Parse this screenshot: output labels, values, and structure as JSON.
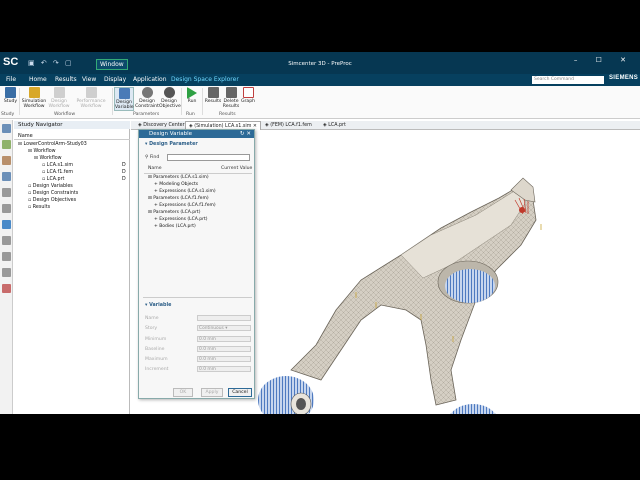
{
  "title_bar": {
    "logo": "SC",
    "window_menu": "Window",
    "title": "Simcenter 3D - PreProc",
    "controls": "– ☐ ✕"
  },
  "menu": {
    "items": [
      "File",
      "Home",
      "Results",
      "View",
      "Display",
      "Application",
      "Design Space Explorer"
    ],
    "search_placeholder": "Search Command",
    "brand": "SIEMENS"
  },
  "ribbon": {
    "buttons": [
      {
        "label": "Study",
        "color": "#3a6ea5"
      },
      {
        "label": "Simulation Workflow",
        "color": "#d8a82a"
      },
      {
        "label": "Design Workflow",
        "color": "#bbbbbb"
      },
      {
        "label": "Performance Workflow",
        "color": "#bbbbbb"
      },
      {
        "label": "Design Variable",
        "color": "#4a7bb7"
      },
      {
        "label": "Design Constraint",
        "color": "#777777"
      },
      {
        "label": "Design Objective",
        "color": "#555555"
      },
      {
        "label": "Run",
        "color": "#2ea043"
      },
      {
        "label": "Results",
        "color": "#555555"
      },
      {
        "label": "Delete Results",
        "color": "#555555"
      },
      {
        "label": "Graph",
        "color": "#c04040"
      }
    ],
    "groups": [
      "Study",
      "Workflow",
      "Parameters",
      "Run",
      "Results"
    ]
  },
  "navigator": {
    "title": "Study Navigator",
    "column": "Name",
    "rows": [
      {
        "label": "LowerControlArm-Study03",
        "mark": ""
      },
      {
        "label": "Workflow",
        "mark": ""
      },
      {
        "label": "Workflow",
        "mark": ""
      },
      {
        "label": "LCA.s1.sim",
        "mark": "D"
      },
      {
        "label": "LCA.f1.fem",
        "mark": "D"
      },
      {
        "label": "LCA.prt",
        "mark": "D"
      },
      {
        "label": "Design Variables",
        "mark": ""
      },
      {
        "label": "Design Constraints",
        "mark": ""
      },
      {
        "label": "Design Objectives",
        "mark": ""
      },
      {
        "label": "Results",
        "mark": ""
      }
    ]
  },
  "tabs": [
    "Discovery Center",
    "(Simulation) LCA.s1.sim",
    "(FEM) LCA.f1.fem",
    "LCA.prt"
  ],
  "dialog": {
    "title": "Design Variable",
    "section_param": "Design Parameter",
    "find_label": "Find",
    "col_name": "Name",
    "col_value": "Current Value",
    "tree": [
      "Parameters (LCA.s1.sim)",
      "Modeling Objects",
      "Expressions (LCA.s1.sim)",
      "Parameters (LCA.f1.fem)",
      "Expressions (LCA.f1.fem)",
      "Parameters (LCA.prt)",
      "Expressions (LCA.prt)",
      "Bodies (LCA.prt)"
    ],
    "section_var": "Variable",
    "fields": [
      {
        "label": "Name",
        "value": ""
      },
      {
        "label": "Story",
        "value": "Continuous"
      },
      {
        "label": "Minimum",
        "value": "0.0"
      },
      {
        "label": "Baseline",
        "value": "0.0"
      },
      {
        "label": "Maximum",
        "value": "0.0"
      },
      {
        "label": "Increment",
        "value": "0.0"
      }
    ],
    "unit": "mm",
    "buttons": {
      "ok": "OK",
      "apply": "Apply",
      "cancel": "Cancel"
    }
  },
  "colors": {
    "title_bar": "#063752",
    "accent": "#6fd9ff",
    "mesh": "#d5cfc4",
    "bushing": "#2f63b5"
  }
}
